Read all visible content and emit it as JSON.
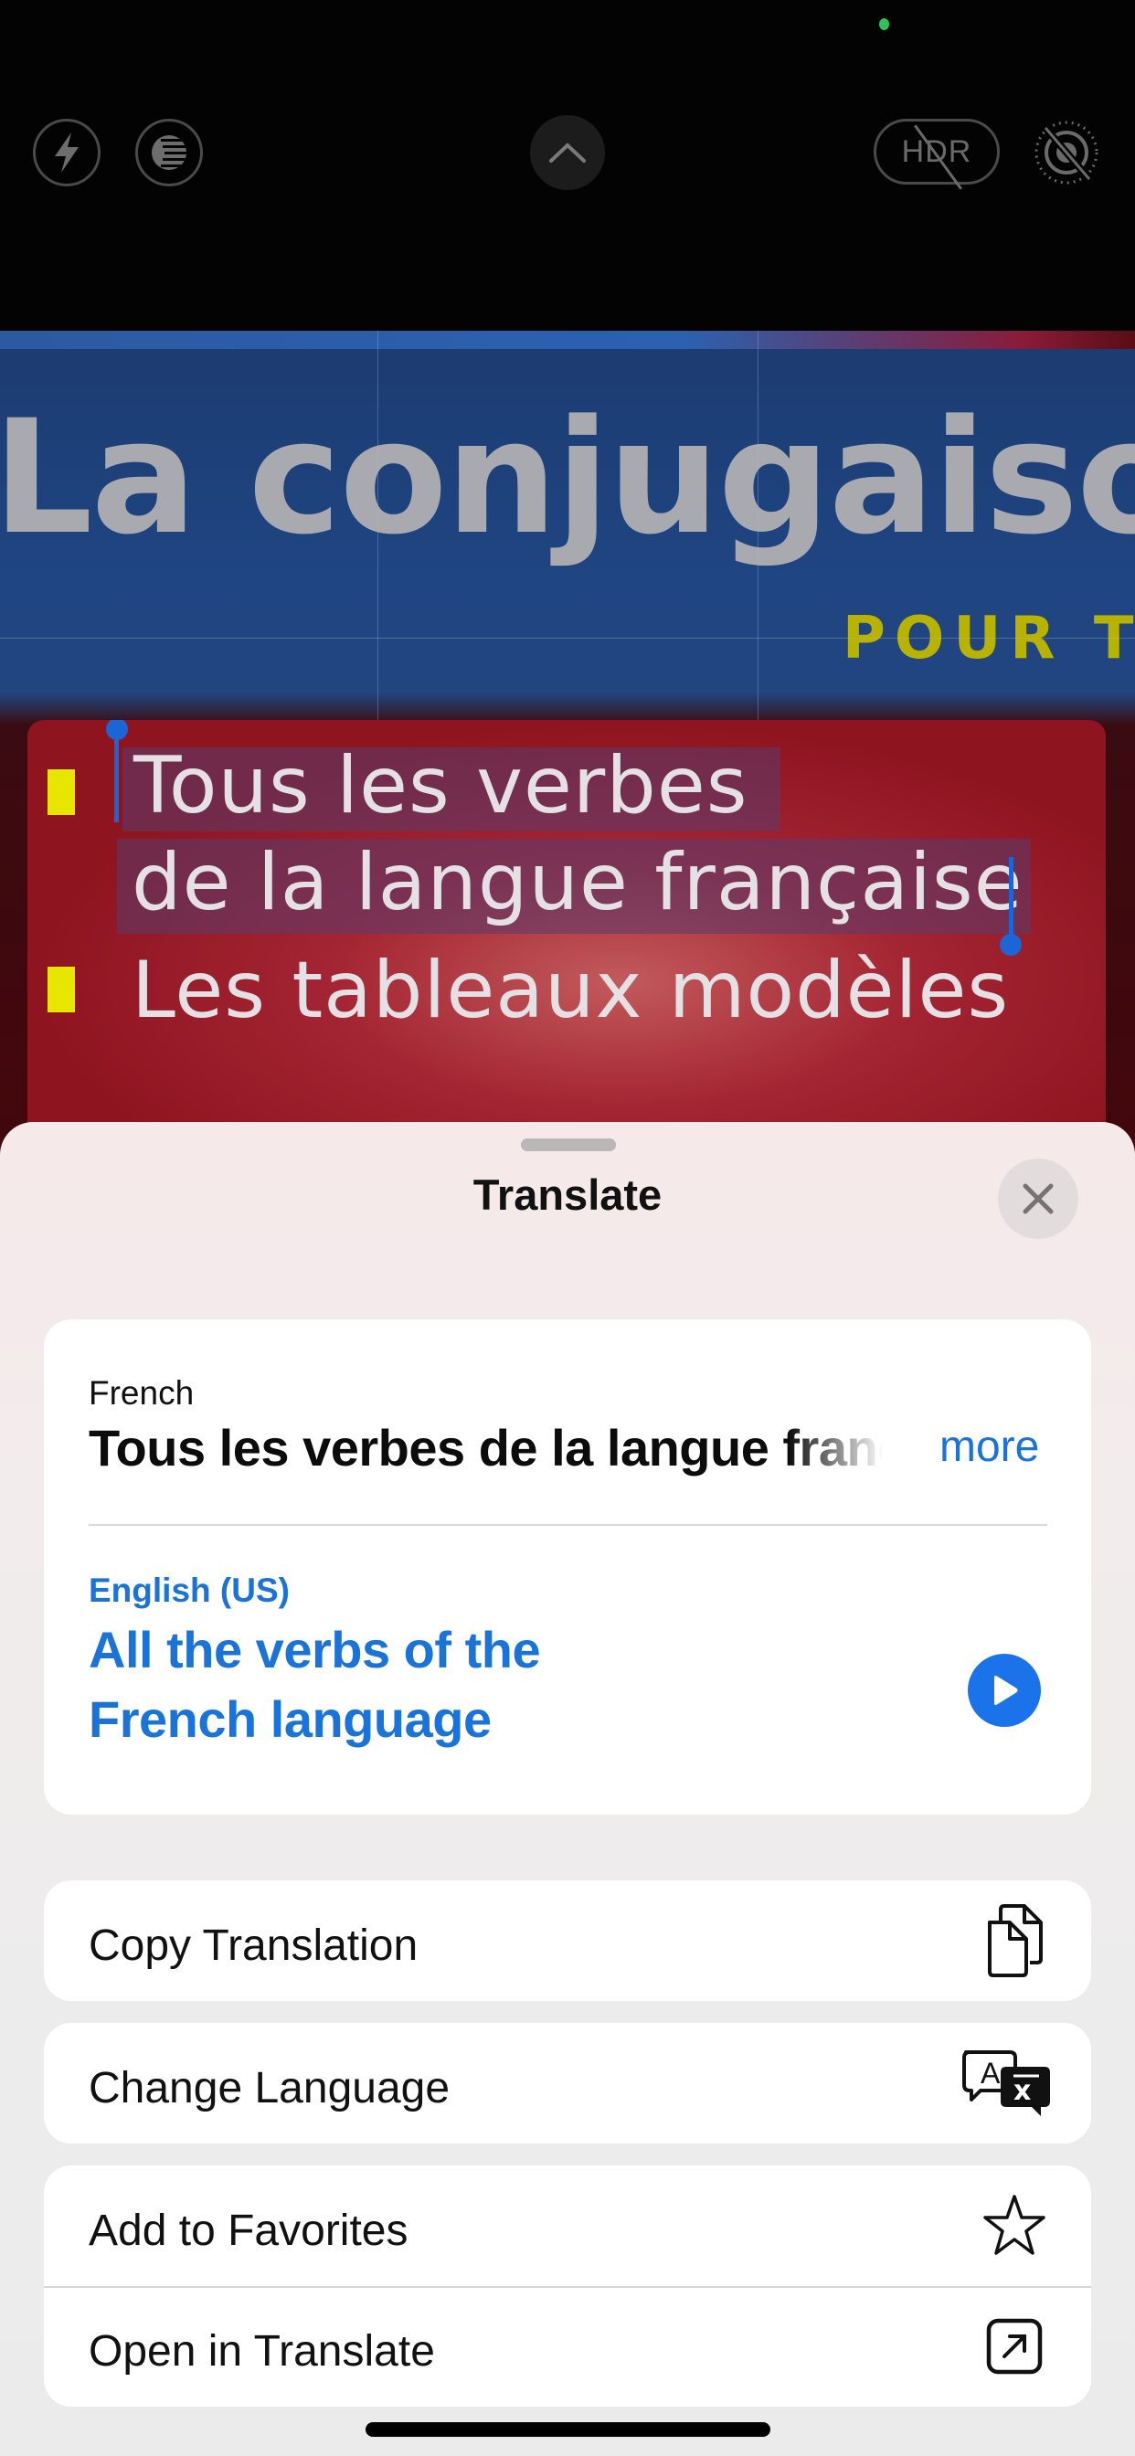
{
  "camera": {
    "top_controls": {
      "flash": {
        "icon": "flash-icon"
      },
      "live_photo": {
        "icon": "live-photo-icon"
      },
      "expand": {
        "icon": "chevron-up-icon"
      },
      "hdr": {
        "label": "HDR",
        "state": "off"
      },
      "live_off": {
        "icon": "live-photo-off-icon"
      }
    },
    "recording_indicator_color": "#30c25a",
    "viewfinder": {
      "cover_title": "La conjugaiso",
      "cover_subtitle": "POUR TO",
      "detected_lines": [
        "Tous les verbes",
        "de la langue française",
        "Les tableaux modèles"
      ]
    }
  },
  "sheet": {
    "title": "Translate",
    "close_icon": "xmark-icon",
    "source": {
      "language": "French",
      "text": "Tous les verbes de la langue française",
      "more_label": "more"
    },
    "target": {
      "language": "English (US)",
      "text": "All the verbs of the French language",
      "play_icon": "play-icon"
    },
    "actions": [
      {
        "label": "Copy Translation",
        "icon": "copy-icon"
      },
      {
        "label": "Change Language",
        "icon": "translate-language-icon"
      },
      {
        "label": "Add to Favorites",
        "icon": "star-icon"
      },
      {
        "label": "Open in Translate",
        "icon": "open-external-icon"
      }
    ]
  },
  "colors": {
    "accent_blue": "#1a73d8",
    "play_button": "#1a73e8",
    "selection_handle": "#1b66d6"
  }
}
